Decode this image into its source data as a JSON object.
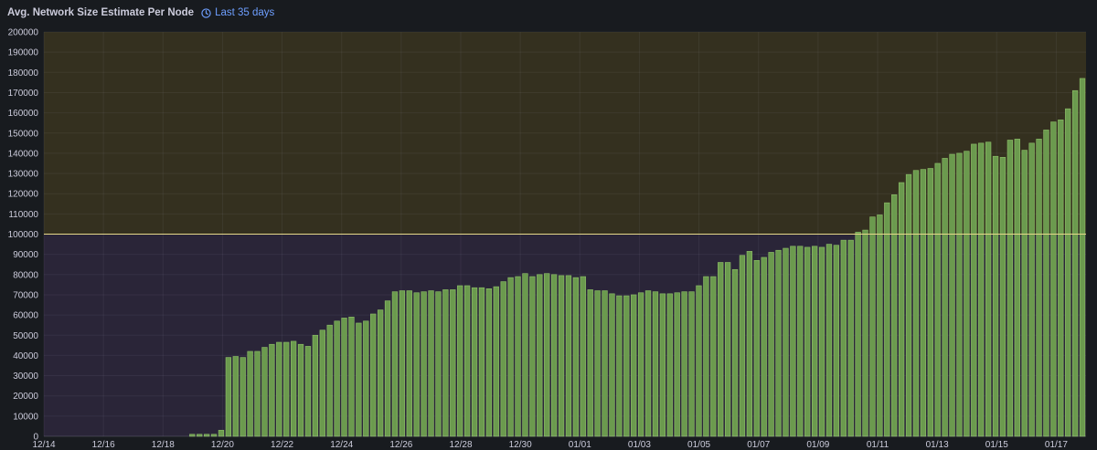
{
  "panel": {
    "title": "Avg. Network Size Estimate Per Node",
    "time_range_label": "Last 35 days",
    "time_range_icon": "clock-icon"
  },
  "colors": {
    "bar_fill": "#6b9a4e",
    "bar_stroke": "#8fc06a",
    "zone_above": "#34301f",
    "zone_below": "#2a2538",
    "threshold_line": "#e6d98a",
    "accent": "#6e9fff"
  },
  "chart_data": {
    "type": "bar",
    "title": "Avg. Network Size Estimate Per Node",
    "xlabel": "",
    "ylabel": "",
    "ylim": [
      0,
      200000
    ],
    "y_ticks": [
      0,
      10000,
      20000,
      30000,
      40000,
      50000,
      60000,
      70000,
      80000,
      90000,
      100000,
      110000,
      120000,
      130000,
      140000,
      150000,
      160000,
      170000,
      180000,
      190000,
      200000
    ],
    "x_start": "12/14",
    "x_end": "01/18",
    "x_ticks": [
      "12/14",
      "12/16",
      "12/18",
      "12/20",
      "12/22",
      "12/24",
      "12/26",
      "12/28",
      "12/30",
      "01/01",
      "01/03",
      "01/05",
      "01/07",
      "01/09",
      "01/11",
      "01/13",
      "01/15",
      "01/17"
    ],
    "threshold": 100000,
    "grid": true,
    "legend": "none",
    "values": [
      0,
      0,
      0,
      0,
      0,
      0,
      0,
      0,
      0,
      0,
      0,
      0,
      0,
      0,
      0,
      0,
      0,
      0,
      0,
      0,
      1000,
      1000,
      1000,
      1000,
      3000,
      39000,
      39500,
      39000,
      42000,
      42000,
      44000,
      45500,
      46500,
      46500,
      47000,
      45500,
      44500,
      50000,
      52500,
      55000,
      57000,
      58500,
      59000,
      56000,
      57000,
      60500,
      62500,
      67000,
      71500,
      72000,
      72000,
      71000,
      71500,
      72000,
      71500,
      72500,
      72500,
      74500,
      74500,
      73500,
      73500,
      73000,
      74000,
      76500,
      78500,
      79000,
      80500,
      79000,
      80000,
      80500,
      80000,
      79500,
      79500,
      78500,
      79000,
      72500,
      72000,
      72000,
      70500,
      69500,
      69500,
      70000,
      71000,
      72000,
      71500,
      70500,
      70500,
      71000,
      71500,
      71500,
      74500,
      79000,
      79000,
      86000,
      86000,
      82500,
      89500,
      91500,
      87000,
      88500,
      91000,
      92000,
      93000,
      94000,
      94000,
      93500,
      94000,
      93500,
      95000,
      94500,
      97000,
      97000,
      101000,
      102000,
      108500,
      109500,
      115500,
      119500,
      125500,
      129500,
      131500,
      132000,
      132500,
      135000,
      137500,
      139500,
      140000,
      141000,
      144500,
      145000,
      145500,
      138500,
      138000,
      146500,
      147000,
      141500,
      145000,
      147000,
      151500,
      155500,
      156500,
      162000,
      171000,
      177000
    ]
  }
}
